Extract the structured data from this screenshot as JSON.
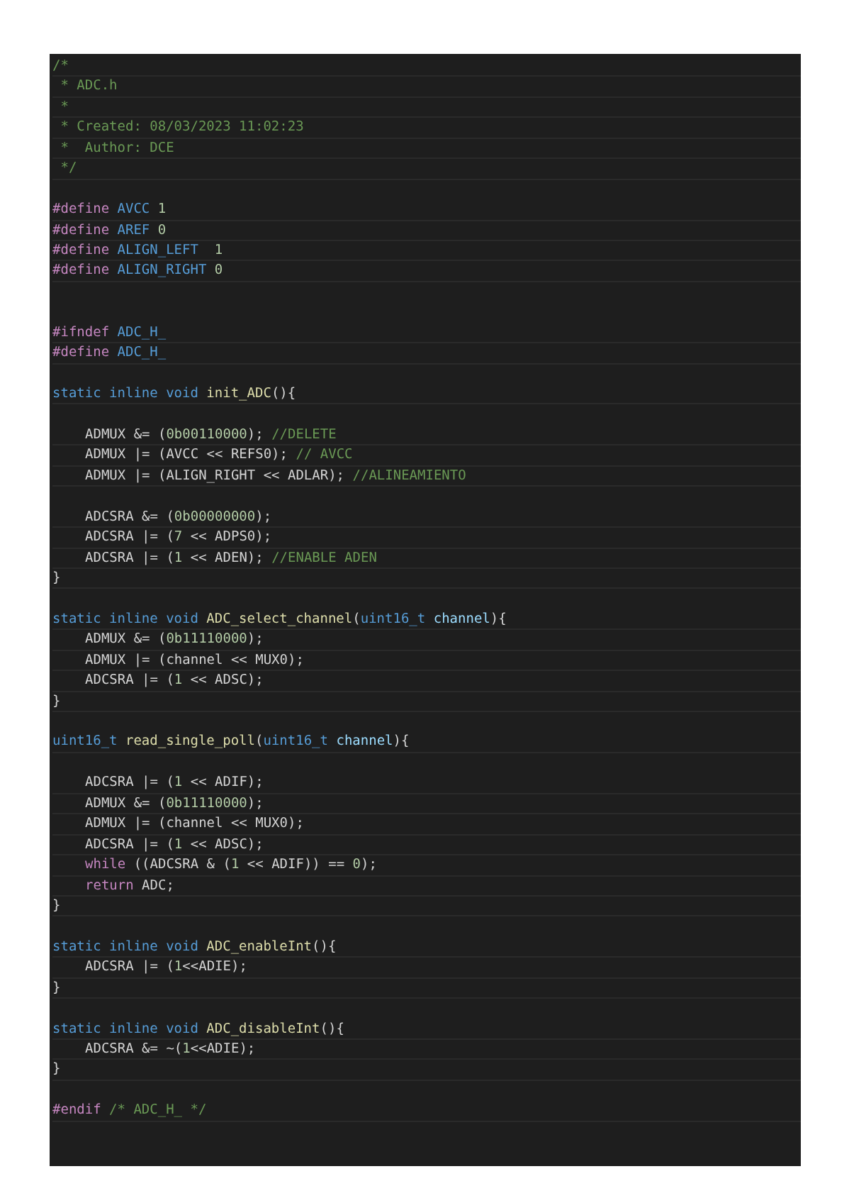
{
  "editor": {
    "lines": [
      {
        "kind": "code",
        "indented": false,
        "tokens": [
          {
            "kind": "comment",
            "text": "/*"
          }
        ]
      },
      {
        "kind": "code",
        "indented": false,
        "tokens": [
          {
            "kind": "comment",
            "text": " * ADC.h"
          }
        ]
      },
      {
        "kind": "code",
        "indented": false,
        "tokens": [
          {
            "kind": "comment",
            "text": " *"
          }
        ]
      },
      {
        "kind": "code",
        "indented": false,
        "tokens": [
          {
            "kind": "comment",
            "text": " * Created: 08/03/2023 11:02:23"
          }
        ]
      },
      {
        "kind": "code",
        "indented": false,
        "tokens": [
          {
            "kind": "comment",
            "text": " *  Author: DCE"
          }
        ]
      },
      {
        "kind": "code",
        "indented": false,
        "tokens": [
          {
            "kind": "comment",
            "text": " */"
          }
        ]
      },
      {
        "kind": "blank"
      },
      {
        "kind": "code",
        "indented": false,
        "tokens": [
          {
            "kind": "directive",
            "text": "#define "
          },
          {
            "kind": "macro",
            "text": "AVCC "
          },
          {
            "kind": "number",
            "text": "1"
          }
        ]
      },
      {
        "kind": "code",
        "indented": false,
        "tokens": [
          {
            "kind": "directive",
            "text": "#define "
          },
          {
            "kind": "macro",
            "text": "AREF "
          },
          {
            "kind": "number",
            "text": "0"
          }
        ]
      },
      {
        "kind": "code",
        "indented": false,
        "tokens": [
          {
            "kind": "directive",
            "text": "#define "
          },
          {
            "kind": "macro",
            "text": "ALIGN_LEFT  "
          },
          {
            "kind": "number",
            "text": "1"
          }
        ]
      },
      {
        "kind": "code",
        "indented": false,
        "tokens": [
          {
            "kind": "directive",
            "text": "#define "
          },
          {
            "kind": "macro",
            "text": "ALIGN_RIGHT "
          },
          {
            "kind": "number",
            "text": "0"
          }
        ]
      },
      {
        "kind": "blank"
      },
      {
        "kind": "blank"
      },
      {
        "kind": "code",
        "indented": false,
        "tokens": [
          {
            "kind": "directive",
            "text": "#ifndef "
          },
          {
            "kind": "macro",
            "text": "ADC_H_"
          }
        ]
      },
      {
        "kind": "code",
        "indented": false,
        "tokens": [
          {
            "kind": "directive",
            "text": "#define "
          },
          {
            "kind": "macro",
            "text": "ADC_H_"
          }
        ]
      },
      {
        "kind": "blank"
      },
      {
        "kind": "code",
        "indented": false,
        "tokens": [
          {
            "kind": "keyword",
            "text": "static inline void "
          },
          {
            "kind": "function",
            "text": "init_ADC"
          },
          {
            "kind": "plain",
            "text": "(){"
          }
        ]
      },
      {
        "kind": "blank"
      },
      {
        "kind": "code",
        "indented": true,
        "tokens": [
          {
            "kind": "plain",
            "text": "ADMUX &= ("
          },
          {
            "kind": "number",
            "text": "0b00110000"
          },
          {
            "kind": "plain",
            "text": "); "
          },
          {
            "kind": "comment",
            "text": "//DELETE"
          }
        ]
      },
      {
        "kind": "code",
        "indented": true,
        "tokens": [
          {
            "kind": "plain",
            "text": "ADMUX |= (AVCC << REFS0); "
          },
          {
            "kind": "comment",
            "text": "// AVCC"
          }
        ]
      },
      {
        "kind": "code",
        "indented": true,
        "tokens": [
          {
            "kind": "plain",
            "text": "ADMUX |= (ALIGN_RIGHT << ADLAR); "
          },
          {
            "kind": "comment",
            "text": "//ALINEAMIENTO"
          }
        ]
      },
      {
        "kind": "blank"
      },
      {
        "kind": "code",
        "indented": true,
        "tokens": [
          {
            "kind": "plain",
            "text": "ADCSRA &= ("
          },
          {
            "kind": "number",
            "text": "0b00000000"
          },
          {
            "kind": "plain",
            "text": ");"
          }
        ]
      },
      {
        "kind": "code",
        "indented": true,
        "tokens": [
          {
            "kind": "plain",
            "text": "ADCSRA |= ("
          },
          {
            "kind": "number",
            "text": "7"
          },
          {
            "kind": "plain",
            "text": " << ADPS0);"
          }
        ]
      },
      {
        "kind": "code",
        "indented": true,
        "tokens": [
          {
            "kind": "plain",
            "text": "ADCSRA |= ("
          },
          {
            "kind": "number",
            "text": "1"
          },
          {
            "kind": "plain",
            "text": " << ADEN); "
          },
          {
            "kind": "comment",
            "text": "//ENABLE ADEN"
          }
        ]
      },
      {
        "kind": "code",
        "indented": false,
        "tokens": [
          {
            "kind": "plain",
            "text": "}"
          }
        ]
      },
      {
        "kind": "blank"
      },
      {
        "kind": "code",
        "indented": false,
        "tokens": [
          {
            "kind": "keyword",
            "text": "static inline void "
          },
          {
            "kind": "function",
            "text": "ADC_select_channel"
          },
          {
            "kind": "plain",
            "text": "("
          },
          {
            "kind": "keyword",
            "text": "uint16_t "
          },
          {
            "kind": "param",
            "text": "channel"
          },
          {
            "kind": "plain",
            "text": "){"
          }
        ]
      },
      {
        "kind": "code",
        "indented": true,
        "tokens": [
          {
            "kind": "plain",
            "text": "ADMUX &= ("
          },
          {
            "kind": "number",
            "text": "0b11110000"
          },
          {
            "kind": "plain",
            "text": ");"
          }
        ]
      },
      {
        "kind": "code",
        "indented": true,
        "tokens": [
          {
            "kind": "plain",
            "text": "ADMUX |= (channel << MUX0);"
          }
        ]
      },
      {
        "kind": "code",
        "indented": true,
        "tokens": [
          {
            "kind": "plain",
            "text": "ADCSRA |= ("
          },
          {
            "kind": "number",
            "text": "1"
          },
          {
            "kind": "plain",
            "text": " << ADSC);"
          }
        ]
      },
      {
        "kind": "code",
        "indented": false,
        "tokens": [
          {
            "kind": "plain",
            "text": "}"
          }
        ]
      },
      {
        "kind": "blank"
      },
      {
        "kind": "code",
        "indented": false,
        "tokens": [
          {
            "kind": "keyword",
            "text": "uint16_t "
          },
          {
            "kind": "function",
            "text": "read_single_poll"
          },
          {
            "kind": "plain",
            "text": "("
          },
          {
            "kind": "keyword",
            "text": "uint16_t "
          },
          {
            "kind": "param",
            "text": "channel"
          },
          {
            "kind": "plain",
            "text": "){"
          }
        ]
      },
      {
        "kind": "blank"
      },
      {
        "kind": "code",
        "indented": true,
        "tokens": [
          {
            "kind": "plain",
            "text": "ADCSRA |= ("
          },
          {
            "kind": "number",
            "text": "1"
          },
          {
            "kind": "plain",
            "text": " << ADIF);"
          }
        ]
      },
      {
        "kind": "code",
        "indented": true,
        "tokens": [
          {
            "kind": "plain",
            "text": "ADMUX &= ("
          },
          {
            "kind": "number",
            "text": "0b11110000"
          },
          {
            "kind": "plain",
            "text": ");"
          }
        ]
      },
      {
        "kind": "code",
        "indented": true,
        "tokens": [
          {
            "kind": "plain",
            "text": "ADMUX |= (channel << MUX0);"
          }
        ]
      },
      {
        "kind": "code",
        "indented": true,
        "tokens": [
          {
            "kind": "plain",
            "text": "ADCSRA |= ("
          },
          {
            "kind": "number",
            "text": "1"
          },
          {
            "kind": "plain",
            "text": " << ADSC);"
          }
        ]
      },
      {
        "kind": "code",
        "indented": true,
        "tokens": [
          {
            "kind": "control",
            "text": "while"
          },
          {
            "kind": "plain",
            "text": " ((ADCSRA & ("
          },
          {
            "kind": "number",
            "text": "1"
          },
          {
            "kind": "plain",
            "text": " << ADIF)) == "
          },
          {
            "kind": "number",
            "text": "0"
          },
          {
            "kind": "plain",
            "text": ");"
          }
        ]
      },
      {
        "kind": "code",
        "indented": true,
        "tokens": [
          {
            "kind": "control",
            "text": "return"
          },
          {
            "kind": "plain",
            "text": " ADC;"
          }
        ]
      },
      {
        "kind": "code",
        "indented": false,
        "tokens": [
          {
            "kind": "plain",
            "text": "}"
          }
        ]
      },
      {
        "kind": "blank"
      },
      {
        "kind": "code",
        "indented": false,
        "tokens": [
          {
            "kind": "keyword",
            "text": "static inline void "
          },
          {
            "kind": "function",
            "text": "ADC_enableInt"
          },
          {
            "kind": "plain",
            "text": "(){"
          }
        ]
      },
      {
        "kind": "code",
        "indented": true,
        "tokens": [
          {
            "kind": "plain",
            "text": "ADCSRA |= ("
          },
          {
            "kind": "number",
            "text": "1"
          },
          {
            "kind": "plain",
            "text": "<<ADIE);"
          }
        ]
      },
      {
        "kind": "code",
        "indented": false,
        "tokens": [
          {
            "kind": "plain",
            "text": "}"
          }
        ]
      },
      {
        "kind": "blank"
      },
      {
        "kind": "code",
        "indented": false,
        "tokens": [
          {
            "kind": "keyword",
            "text": "static inline void "
          },
          {
            "kind": "function",
            "text": "ADC_disableInt"
          },
          {
            "kind": "plain",
            "text": "(){"
          }
        ]
      },
      {
        "kind": "code",
        "indented": true,
        "tokens": [
          {
            "kind": "plain",
            "text": "ADCSRA &= ~("
          },
          {
            "kind": "number",
            "text": "1"
          },
          {
            "kind": "plain",
            "text": "<<ADIE);"
          }
        ]
      },
      {
        "kind": "code",
        "indented": false,
        "tokens": [
          {
            "kind": "plain",
            "text": "}"
          }
        ]
      },
      {
        "kind": "blank"
      },
      {
        "kind": "code",
        "indented": false,
        "tokens": [
          {
            "kind": "directive",
            "text": "#endif "
          },
          {
            "kind": "comment",
            "text": "/* ADC_H_ */"
          }
        ]
      }
    ]
  }
}
